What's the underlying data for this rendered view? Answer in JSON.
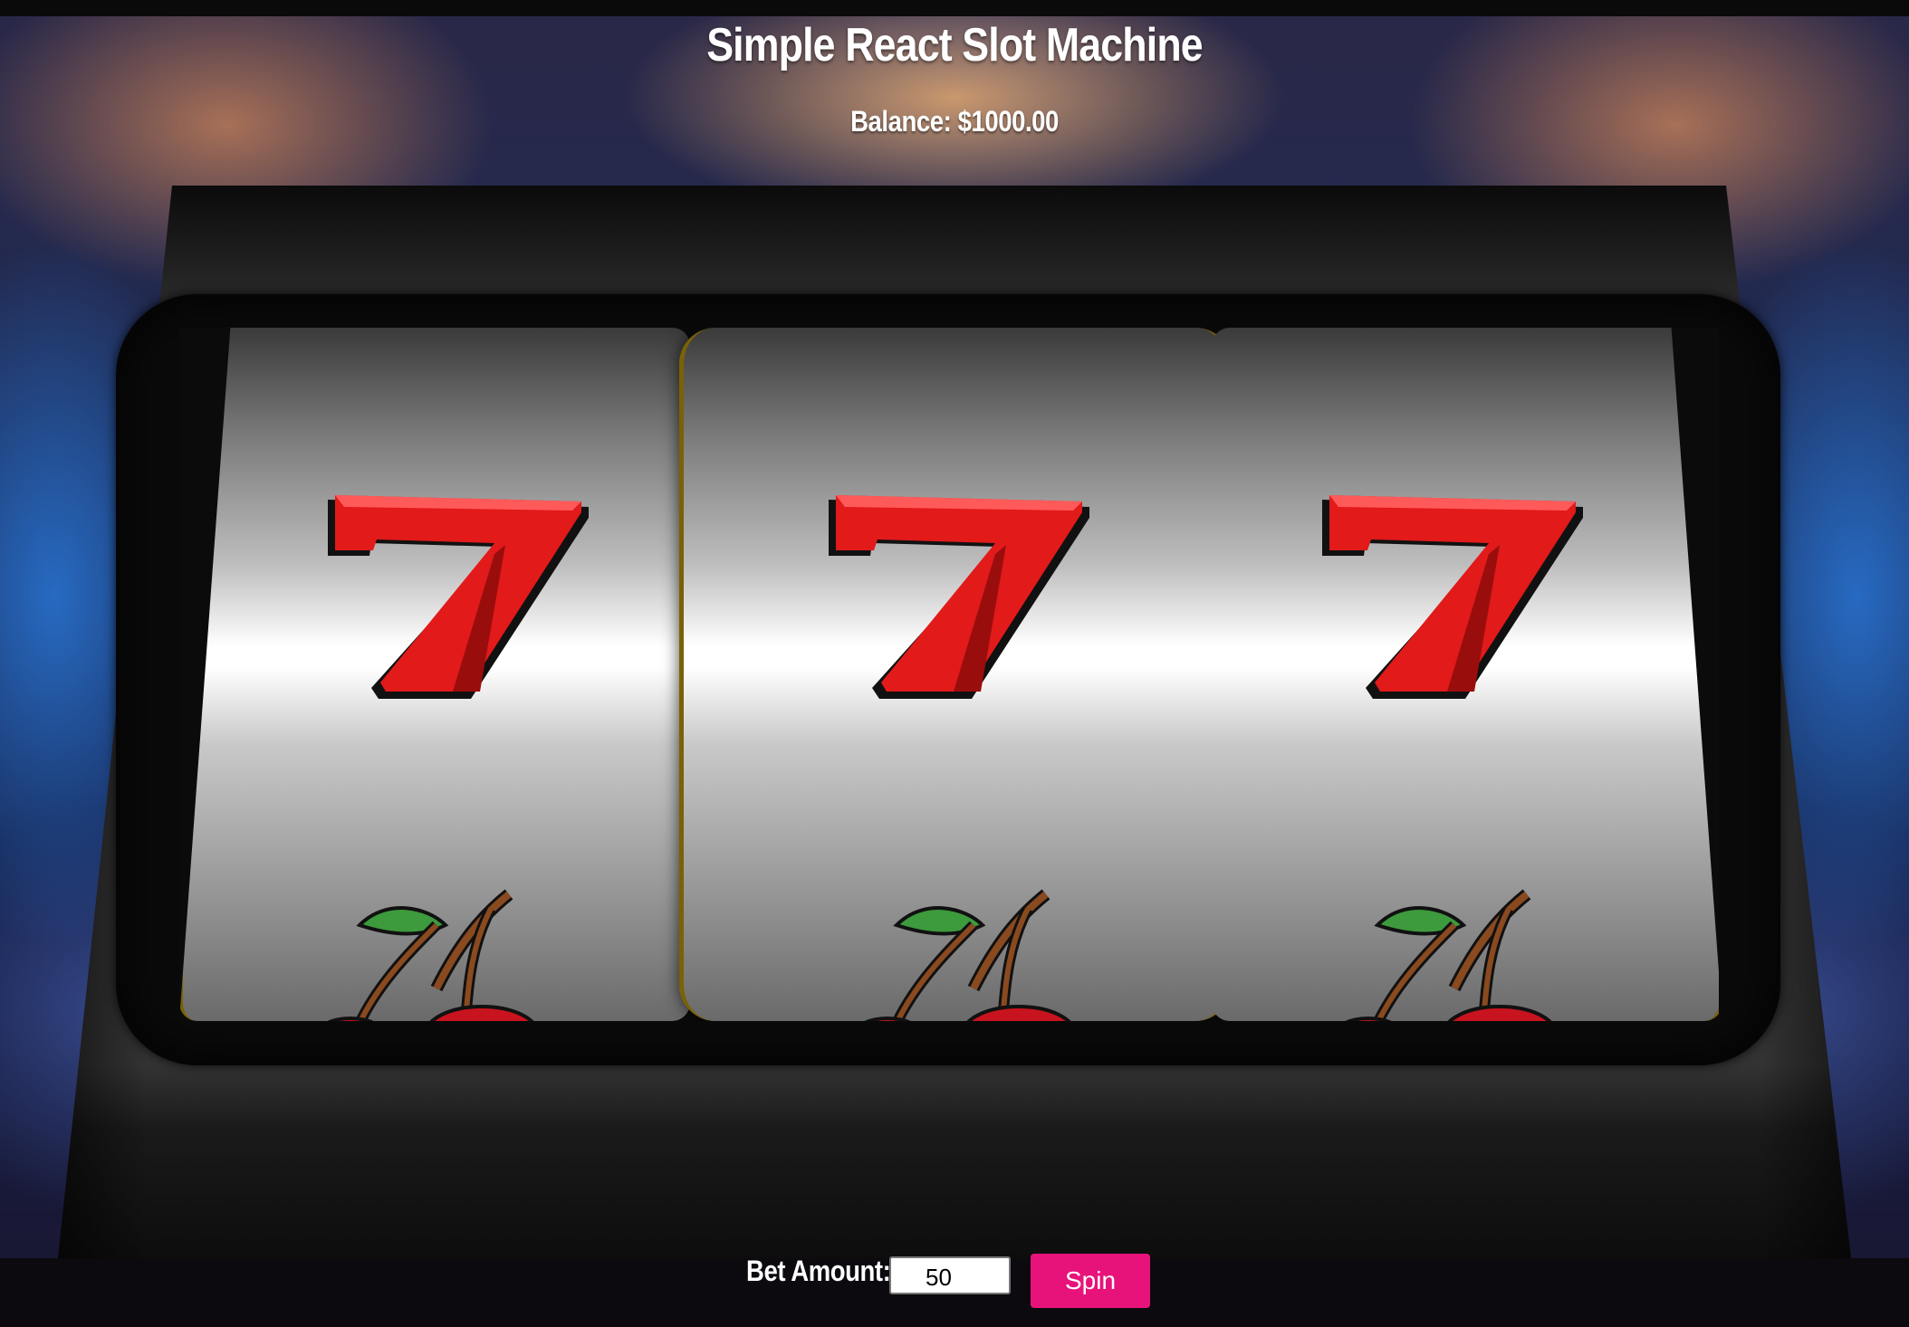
{
  "app": {
    "title": "Simple React Slot Machine",
    "balance_text": "Balance: $1000.00"
  },
  "reels": [
    {
      "symbols": [
        "seven-icon",
        "cherry-icon"
      ]
    },
    {
      "symbols": [
        "seven-icon",
        "cherry-icon"
      ]
    },
    {
      "symbols": [
        "seven-icon",
        "cherry-icon"
      ]
    }
  ],
  "controls": {
    "bet_label": "Bet Amount:",
    "bet_value": "50",
    "spin_label": "Spin"
  },
  "colors": {
    "spin_button": "#e8137a",
    "seven_red": "#e01010",
    "reel_border_gold": "#7a6206"
  }
}
